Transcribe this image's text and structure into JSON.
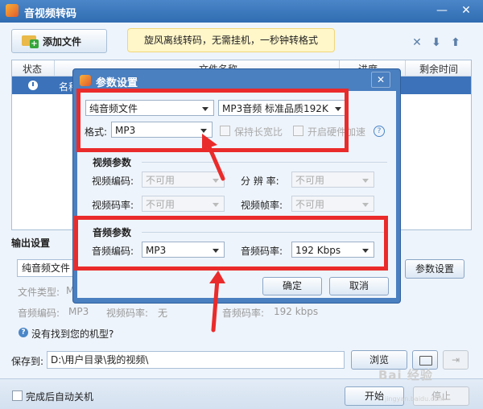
{
  "window": {
    "title": "音视频转码",
    "min": "—",
    "close": "✕"
  },
  "toolbar": {
    "add_file": "添加文件",
    "promo": "旋风离线转码，无需挂机，一秒钟转格式",
    "delete": "✕",
    "down": "⬇",
    "up": "⬆"
  },
  "filelist": {
    "columns": [
      "状态",
      "文件名称",
      "进度",
      "剩余时间"
    ],
    "row_name": "名称"
  },
  "output": {
    "title": "输出设置",
    "format_value": "纯音频文件",
    "param_button": "参数设置",
    "file_type_label": "文件类型:",
    "file_type_value": "M",
    "audio_codec_label": "音频编码:",
    "audio_codec_value": "MP3",
    "video_bitrate_label": "视频码率:",
    "video_bitrate_value": "无",
    "audio_bitrate_label": "音频码率:",
    "audio_bitrate_value": "192 kbps",
    "help_link": "没有找到您的机型?"
  },
  "save": {
    "label": "保存到:",
    "path": "D:\\用户目录\\我的视频\\",
    "browse": "浏览"
  },
  "bottom": {
    "shutdown": "完成后自动关机",
    "start": "开始",
    "stop": "停止"
  },
  "watermark": {
    "main": "Bai 经验",
    "sub": "jingyan.baidu.com"
  },
  "dialog": {
    "title": "参数设置",
    "close": "✕",
    "type_select": "纯音频文件",
    "quality_select": "MP3音频 标准品质192K",
    "format_label": "格式:",
    "format_select": "MP3",
    "keep_ratio": "保持长宽比",
    "hw_accel": "开启硬件加速",
    "video_group": "视频参数",
    "video_codec_label": "视频编码:",
    "video_codec_value": "不可用",
    "resolution_label": "分 辨 率:",
    "resolution_value": "不可用",
    "video_bitrate_label": "视频码率:",
    "video_bitrate_value": "不可用",
    "framerate_label": "视频帧率:",
    "framerate_value": "不可用",
    "audio_group": "音频参数",
    "audio_codec_label": "音频编码:",
    "audio_codec_value": "MP3",
    "audio_bitrate_label": "音频码率:",
    "audio_bitrate_value": "192 Kbps",
    "ok": "确定",
    "cancel": "取消"
  },
  "colors": {
    "accent": "#3b72b9",
    "annotation": "#ea2b2b",
    "promo_bg": "#fff6c9"
  }
}
